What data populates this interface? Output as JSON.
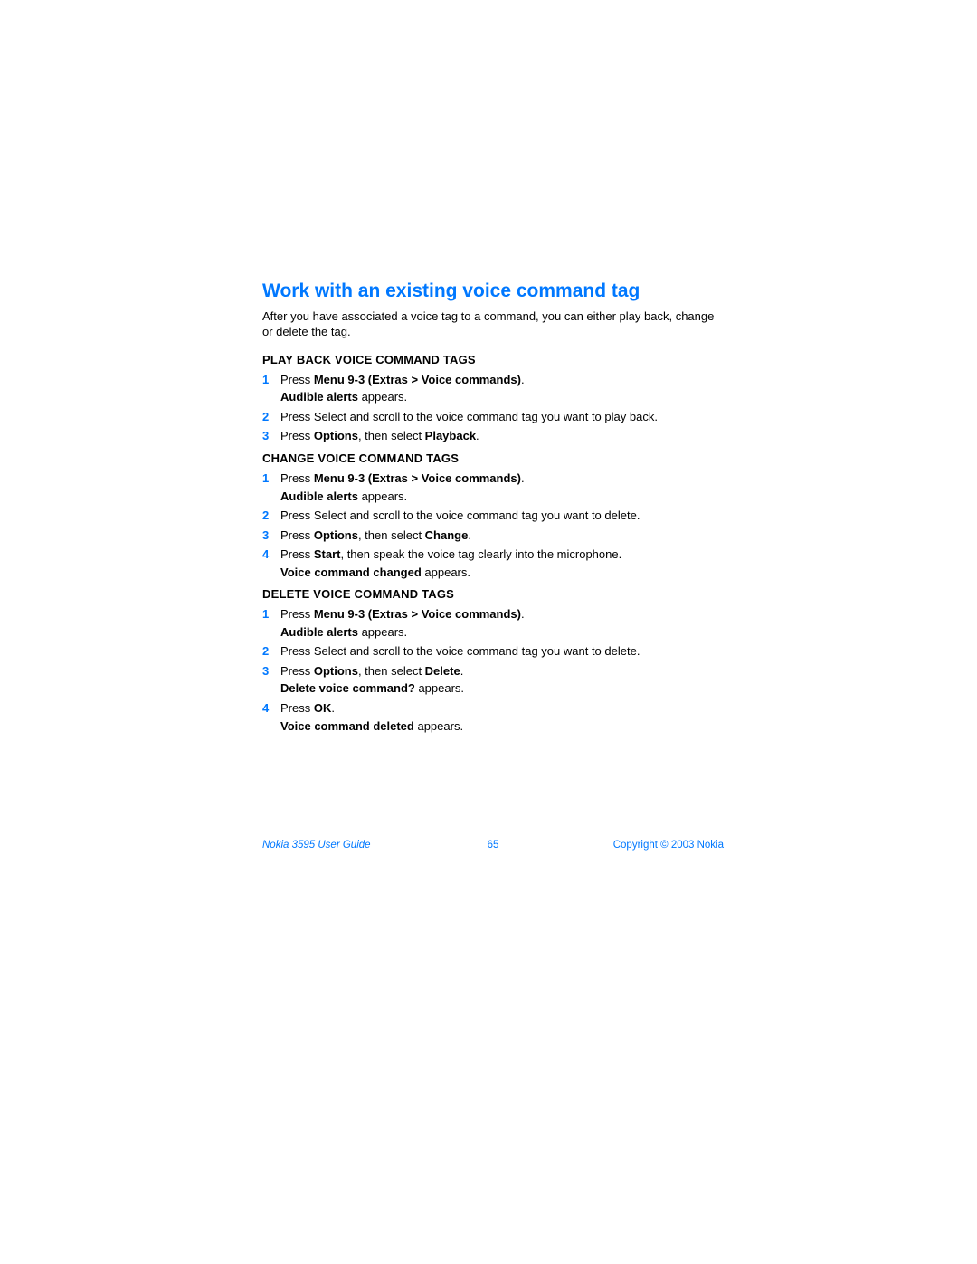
{
  "title": "Work with an existing voice command tag",
  "intro": "After you have associated a voice tag to a command, you can either play back, change or delete the tag.",
  "sections": [
    {
      "heading": "PLAY BACK VOICE COMMAND TAGS",
      "steps": [
        {
          "num": "1",
          "lines": [
            [
              {
                "t": "Press ",
                "b": false
              },
              {
                "t": "Menu 9-3 (Extras > Voice commands)",
                "b": true
              },
              {
                "t": ".",
                "b": false
              }
            ],
            [
              {
                "t": "Audible alerts",
                "b": true
              },
              {
                "t": " appears.",
                "b": false
              }
            ]
          ]
        },
        {
          "num": "2",
          "lines": [
            [
              {
                "t": "Press Select and scroll to the voice command tag you want to play back.",
                "b": false
              }
            ]
          ]
        },
        {
          "num": "3",
          "lines": [
            [
              {
                "t": "Press ",
                "b": false
              },
              {
                "t": "Options",
                "b": true
              },
              {
                "t": ", then select ",
                "b": false
              },
              {
                "t": "Playback",
                "b": true
              },
              {
                "t": ".",
                "b": false
              }
            ]
          ]
        }
      ]
    },
    {
      "heading": "CHANGE VOICE COMMAND TAGS",
      "steps": [
        {
          "num": "1",
          "lines": [
            [
              {
                "t": "Press ",
                "b": false
              },
              {
                "t": "Menu 9-3 (Extras > Voice commands)",
                "b": true
              },
              {
                "t": ".",
                "b": false
              }
            ],
            [
              {
                "t": "Audible alerts",
                "b": true
              },
              {
                "t": " appears.",
                "b": false
              }
            ]
          ]
        },
        {
          "num": "2",
          "lines": [
            [
              {
                "t": "Press Select and scroll to the voice command tag you want to delete.",
                "b": false
              }
            ]
          ]
        },
        {
          "num": "3",
          "lines": [
            [
              {
                "t": "Press ",
                "b": false
              },
              {
                "t": "Options",
                "b": true
              },
              {
                "t": ", then select ",
                "b": false
              },
              {
                "t": "Change",
                "b": true
              },
              {
                "t": ".",
                "b": false
              }
            ]
          ]
        },
        {
          "num": "4",
          "lines": [
            [
              {
                "t": "Press ",
                "b": false
              },
              {
                "t": "Start",
                "b": true
              },
              {
                "t": ", then speak the voice tag clearly into the microphone.",
                "b": false
              }
            ],
            [
              {
                "t": "Voice command changed",
                "b": true
              },
              {
                "t": " appears.",
                "b": false
              }
            ]
          ]
        }
      ]
    },
    {
      "heading": "DELETE VOICE COMMAND TAGS",
      "steps": [
        {
          "num": "1",
          "lines": [
            [
              {
                "t": "Press ",
                "b": false
              },
              {
                "t": "Menu 9-3 (Extras > Voice commands)",
                "b": true
              },
              {
                "t": ".",
                "b": false
              }
            ],
            [
              {
                "t": "Audible alerts",
                "b": true
              },
              {
                "t": " appears.",
                "b": false
              }
            ]
          ]
        },
        {
          "num": "2",
          "lines": [
            [
              {
                "t": "Press Select and scroll to the voice command tag you want to delete.",
                "b": false
              }
            ]
          ]
        },
        {
          "num": "3",
          "lines": [
            [
              {
                "t": "Press ",
                "b": false
              },
              {
                "t": "Options",
                "b": true
              },
              {
                "t": ", then select ",
                "b": false
              },
              {
                "t": "Delete",
                "b": true
              },
              {
                "t": ".",
                "b": false
              }
            ],
            [
              {
                "t": "Delete voice command?",
                "b": true
              },
              {
                "t": " appears.",
                "b": false
              }
            ]
          ]
        },
        {
          "num": "4",
          "lines": [
            [
              {
                "t": "Press ",
                "b": false
              },
              {
                "t": "OK",
                "b": true
              },
              {
                "t": ".",
                "b": false
              }
            ],
            [
              {
                "t": "Voice command deleted",
                "b": true
              },
              {
                "t": " appears.",
                "b": false
              }
            ]
          ]
        }
      ]
    }
  ],
  "footer": {
    "left": "Nokia 3595 User Guide",
    "center": "65",
    "right": "Copyright © 2003 Nokia"
  }
}
